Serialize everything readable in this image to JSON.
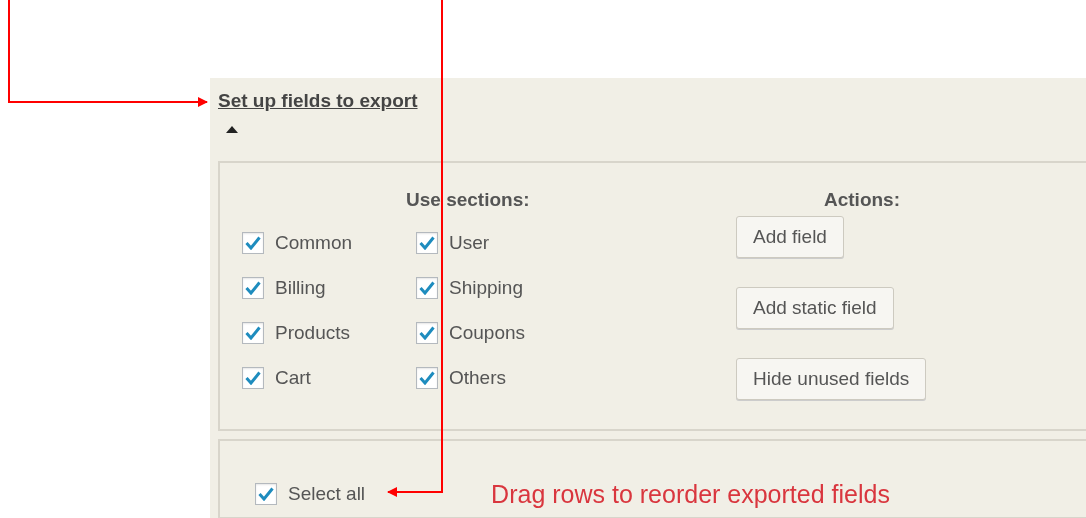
{
  "panel": {
    "title": "Set up fields to export",
    "sections": {
      "heading": "Use sections:",
      "items": [
        {
          "label": "Common",
          "checked": true
        },
        {
          "label": "User",
          "checked": true
        },
        {
          "label": "Billing",
          "checked": true
        },
        {
          "label": "Shipping",
          "checked": true
        },
        {
          "label": "Products",
          "checked": true
        },
        {
          "label": "Coupons",
          "checked": true
        },
        {
          "label": "Cart",
          "checked": true
        },
        {
          "label": "Others",
          "checked": true
        }
      ]
    },
    "actions": {
      "heading": "Actions:",
      "buttons": [
        "Add field",
        "Add static field",
        "Hide unused fields"
      ]
    },
    "select_all": {
      "label": "Select all",
      "checked": true
    },
    "hint": "Drag rows to reorder exported fields"
  }
}
